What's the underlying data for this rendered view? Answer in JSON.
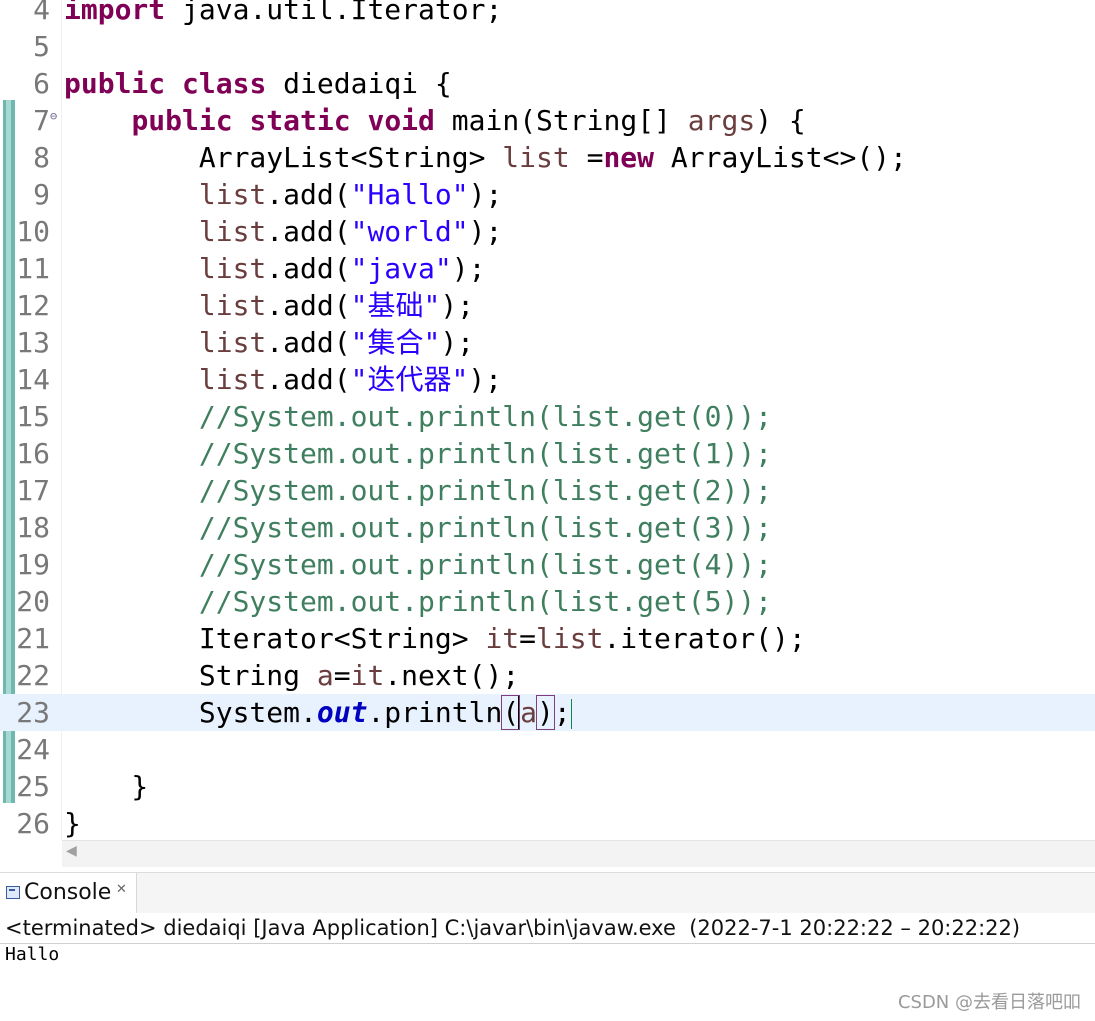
{
  "editor": {
    "lines": [
      {
        "n": "4",
        "segs": [
          {
            "t": "import",
            "c": "kw"
          },
          {
            "t": " java.util.Iterator;"
          }
        ]
      },
      {
        "n": "5",
        "segs": []
      },
      {
        "n": "6",
        "segs": [
          {
            "t": "public",
            "c": "kw"
          },
          {
            "t": " "
          },
          {
            "t": "class",
            "c": "kw"
          },
          {
            "t": " diedaiqi {"
          }
        ]
      },
      {
        "n": "7",
        "fold": true,
        "segs": [
          {
            "t": "    "
          },
          {
            "t": "public",
            "c": "kw"
          },
          {
            "t": " "
          },
          {
            "t": "static",
            "c": "kw"
          },
          {
            "t": " "
          },
          {
            "t": "void",
            "c": "kw"
          },
          {
            "t": " main(String[] "
          },
          {
            "t": "args",
            "c": "var"
          },
          {
            "t": ") {"
          }
        ]
      },
      {
        "n": "8",
        "segs": [
          {
            "t": "        ArrayList<String> "
          },
          {
            "t": "list",
            "c": "var"
          },
          {
            "t": " ="
          },
          {
            "t": "new",
            "c": "kw"
          },
          {
            "t": " ArrayList<>();"
          }
        ]
      },
      {
        "n": "9",
        "segs": [
          {
            "t": "        "
          },
          {
            "t": "list",
            "c": "var"
          },
          {
            "t": ".add("
          },
          {
            "t": "\"Hallo\"",
            "c": "str"
          },
          {
            "t": ");"
          }
        ]
      },
      {
        "n": "10",
        "segs": [
          {
            "t": "        "
          },
          {
            "t": "list",
            "c": "var"
          },
          {
            "t": ".add("
          },
          {
            "t": "\"world\"",
            "c": "str"
          },
          {
            "t": ");"
          }
        ]
      },
      {
        "n": "11",
        "segs": [
          {
            "t": "        "
          },
          {
            "t": "list",
            "c": "var"
          },
          {
            "t": ".add("
          },
          {
            "t": "\"java\"",
            "c": "str"
          },
          {
            "t": ");"
          }
        ]
      },
      {
        "n": "12",
        "segs": [
          {
            "t": "        "
          },
          {
            "t": "list",
            "c": "var"
          },
          {
            "t": ".add("
          },
          {
            "t": "\"基础\"",
            "c": "str"
          },
          {
            "t": ");"
          }
        ]
      },
      {
        "n": "13",
        "segs": [
          {
            "t": "        "
          },
          {
            "t": "list",
            "c": "var"
          },
          {
            "t": ".add("
          },
          {
            "t": "\"集合\"",
            "c": "str"
          },
          {
            "t": ");"
          }
        ]
      },
      {
        "n": "14",
        "segs": [
          {
            "t": "        "
          },
          {
            "t": "list",
            "c": "var"
          },
          {
            "t": ".add("
          },
          {
            "t": "\"迭代器\"",
            "c": "str"
          },
          {
            "t": ");"
          }
        ]
      },
      {
        "n": "15",
        "segs": [
          {
            "t": "        "
          },
          {
            "t": "//System.out.println(list.get(0));",
            "c": "cmt"
          }
        ]
      },
      {
        "n": "16",
        "segs": [
          {
            "t": "        "
          },
          {
            "t": "//System.out.println(list.get(1));",
            "c": "cmt"
          }
        ]
      },
      {
        "n": "17",
        "segs": [
          {
            "t": "        "
          },
          {
            "t": "//System.out.println(list.get(2));",
            "c": "cmt"
          }
        ]
      },
      {
        "n": "18",
        "segs": [
          {
            "t": "        "
          },
          {
            "t": "//System.out.println(list.get(3));",
            "c": "cmt"
          }
        ]
      },
      {
        "n": "19",
        "segs": [
          {
            "t": "        "
          },
          {
            "t": "//System.out.println(list.get(4));",
            "c": "cmt"
          }
        ]
      },
      {
        "n": "20",
        "segs": [
          {
            "t": "        "
          },
          {
            "t": "//System.out.println(list.get(5));",
            "c": "cmt"
          }
        ]
      },
      {
        "n": "21",
        "segs": [
          {
            "t": "        Iterator<String> "
          },
          {
            "t": "it",
            "c": "var"
          },
          {
            "t": "="
          },
          {
            "t": "list",
            "c": "var"
          },
          {
            "t": ".iterator();"
          }
        ]
      },
      {
        "n": "22",
        "segs": [
          {
            "t": "        String "
          },
          {
            "t": "a",
            "c": "var"
          },
          {
            "t": "="
          },
          {
            "t": "it",
            "c": "var"
          },
          {
            "t": ".next();"
          }
        ]
      },
      {
        "n": "23",
        "current": true,
        "segs": [
          {
            "t": "        System."
          },
          {
            "t": "out",
            "c": "fld"
          },
          {
            "t": ".println"
          },
          {
            "t": "(",
            "c": "mb"
          },
          {
            "t": "a",
            "c": "var caret"
          },
          {
            "t": ")",
            "c": "mb"
          },
          {
            "t": ";"
          },
          {
            "t": "",
            "c": "edit-caret"
          }
        ]
      },
      {
        "n": "24",
        "segs": []
      },
      {
        "n": "25",
        "segs": [
          {
            "t": "    }"
          }
        ]
      },
      {
        "n": "26",
        "segs": [
          {
            "t": "}"
          }
        ]
      }
    ]
  },
  "console": {
    "tab_label": "Console",
    "close_glyph": "✕",
    "status": "<terminated> diedaiqi [Java Application] C:\\javar\\bin\\javaw.exe  (2022-7-1 20:22:22 – 20:22:22)",
    "output": [
      "Hallo"
    ]
  },
  "scrollbar": {
    "left_arrow": "◀"
  },
  "watermark": "CSDN @去看日落吧吅"
}
